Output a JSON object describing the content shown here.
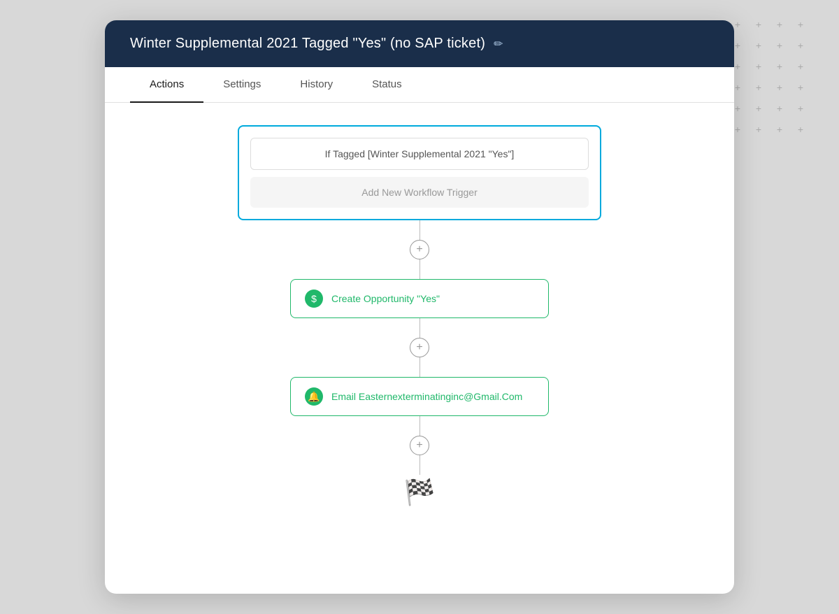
{
  "header": {
    "title": "Winter Supplemental 2021 Tagged \"Yes\" (no SAP ticket)",
    "edit_icon": "✏"
  },
  "tabs": [
    {
      "id": "actions",
      "label": "Actions",
      "active": true
    },
    {
      "id": "settings",
      "label": "Settings",
      "active": false
    },
    {
      "id": "history",
      "label": "History",
      "active": false
    },
    {
      "id": "status",
      "label": "Status",
      "active": false
    }
  ],
  "workflow": {
    "trigger_condition": "If Tagged [Winter Supplemental 2021 \"Yes\"]",
    "add_trigger_label": "Add New Workflow Trigger",
    "steps": [
      {
        "id": "step-1",
        "icon": "$",
        "label": "Create Opportunity \"Yes\"",
        "icon_type": "opportunity"
      },
      {
        "id": "step-2",
        "icon": "🔔",
        "label": "Email Easternexterminatinginc@Gmail.Com",
        "icon_type": "email"
      }
    ]
  },
  "plus_signs": [
    "+",
    "+",
    "+",
    "+",
    "+",
    "+",
    "+",
    "+",
    "+",
    "+",
    "+",
    "+",
    "+",
    "+",
    "+",
    "+",
    "+",
    "+",
    "+",
    "+",
    "+",
    "+",
    "+",
    "+",
    "+",
    "+",
    "+",
    "+",
    "+",
    "+",
    "+",
    "+",
    "+",
    "+",
    "+",
    "+",
    "+",
    "+",
    "+",
    "+",
    "+",
    "+",
    "+",
    "+",
    "+",
    "+",
    "+",
    "+",
    "+",
    "+",
    "+",
    "+",
    "+",
    "+",
    "+",
    "+",
    "+",
    "+",
    "+",
    "+"
  ]
}
